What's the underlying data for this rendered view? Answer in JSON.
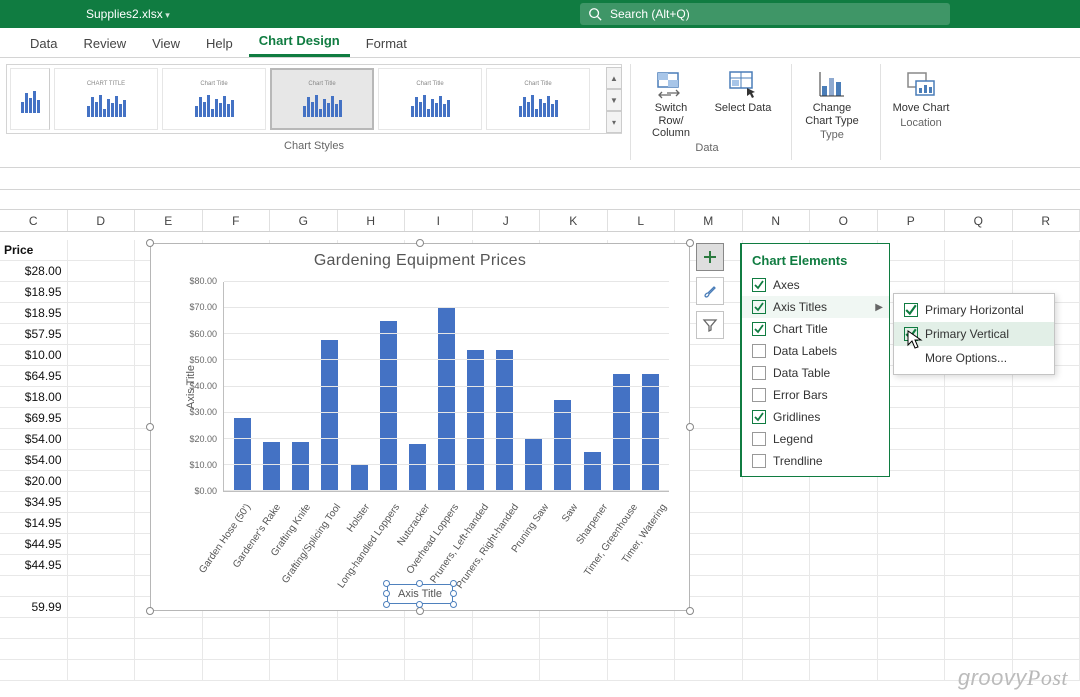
{
  "titlebar": {
    "filename": "Supplies2.xlsx",
    "search_placeholder": "Search (Alt+Q)"
  },
  "tabs": [
    "Data",
    "Review",
    "View",
    "Help",
    "Chart Design",
    "Format"
  ],
  "active_tab": "Chart Design",
  "ribbon": {
    "styles_label": "Chart Styles",
    "buttons": {
      "switch_row": "Switch Row/\nColumn",
      "select_data": "Select\nData",
      "change_type": "Change\nChart Type",
      "move_chart": "Move\nChart"
    },
    "groups": {
      "data": "Data",
      "type": "Type",
      "location": "Location"
    }
  },
  "columns": [
    "C",
    "D",
    "E",
    "F",
    "G",
    "H",
    "I",
    "J",
    "K",
    "L",
    "M",
    "N",
    "O",
    "P",
    "Q",
    "R"
  ],
  "price_header": "Price",
  "prices": [
    "$28.00",
    "$18.95",
    "$18.95",
    "$57.95",
    "$10.00",
    "$64.95",
    "$18.00",
    "$69.95",
    "$54.00",
    "$54.00",
    "$20.00",
    "$34.95",
    "$14.95",
    "$44.95",
    "$44.95",
    "",
    "59.99"
  ],
  "chart_tools": {
    "elements_header": "Chart Elements",
    "items": [
      {
        "label": "Axes",
        "checked": true
      },
      {
        "label": "Axis Titles",
        "checked": true,
        "submenu": true
      },
      {
        "label": "Chart Title",
        "checked": true
      },
      {
        "label": "Data Labels",
        "checked": false
      },
      {
        "label": "Data Table",
        "checked": false
      },
      {
        "label": "Error Bars",
        "checked": false
      },
      {
        "label": "Gridlines",
        "checked": true
      },
      {
        "label": "Legend",
        "checked": false
      },
      {
        "label": "Trendline",
        "checked": false
      }
    ],
    "submenu": {
      "primary_h": "Primary Horizontal",
      "primary_v": "Primary Vertical",
      "more": "More Options..."
    }
  },
  "chart_data": {
    "type": "bar",
    "title": "Gardening Equipment Prices",
    "xlabel": "Axis Title",
    "ylabel": "Axis Title",
    "ylim": [
      0,
      80
    ],
    "ytick_step": 10,
    "yticks": [
      "$0.00",
      "$10.00",
      "$20.00",
      "$30.00",
      "$40.00",
      "$50.00",
      "$60.00",
      "$70.00",
      "$80.00"
    ],
    "categories": [
      "Garden Hose (50')",
      "Gardener's Rake",
      "Grafting Knife",
      "Grafting/Splicing Tool",
      "Holster",
      "Long-handled Loppers",
      "Nutcracker",
      "Overhead Loppers",
      "Pruners, Left-handed",
      "Pruners, Right-handed",
      "Pruning Saw",
      "Saw",
      "Sharpener",
      "Timer, Greenhouse",
      "Timer, Watering"
    ],
    "values": [
      28.0,
      18.95,
      18.95,
      57.95,
      10.0,
      64.95,
      18.0,
      69.95,
      54.0,
      54.0,
      20.0,
      34.95,
      14.95,
      44.95,
      44.95
    ]
  },
  "watermark": "groovyPost"
}
